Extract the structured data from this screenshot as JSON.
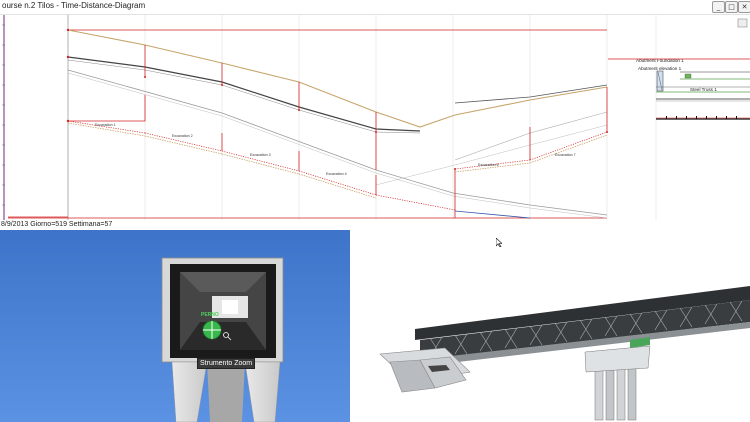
{
  "window": {
    "title": "ourse n.2 Tilos -  Time-Distance-Diagram",
    "buttons": {
      "minimize": "_",
      "maximize": "□",
      "close": "✕"
    }
  },
  "diagram": {
    "activities": [
      "Excavation 1",
      "Excavation 2",
      "Excavation 3",
      "Excavation 4",
      "Excavation 6",
      "Excavation 7"
    ],
    "header_labels": {
      "abutment_foundation": "Abutment Foundation 1",
      "abutment_elevation": "Abutment elevation 1",
      "steel_truss": "Steel Truss 1"
    }
  },
  "status_bar": {
    "text": "8/9/2013 Giorno=519 Settimana=57"
  },
  "viewport": {
    "tool_label": "PERNO",
    "tooltip": "Strumento Zoom"
  },
  "colors": {
    "viewport_sky": "#4a80d6",
    "accent_red": "#d22222",
    "tan_line": "#c7a56a",
    "grid": "#d9d9d9"
  }
}
